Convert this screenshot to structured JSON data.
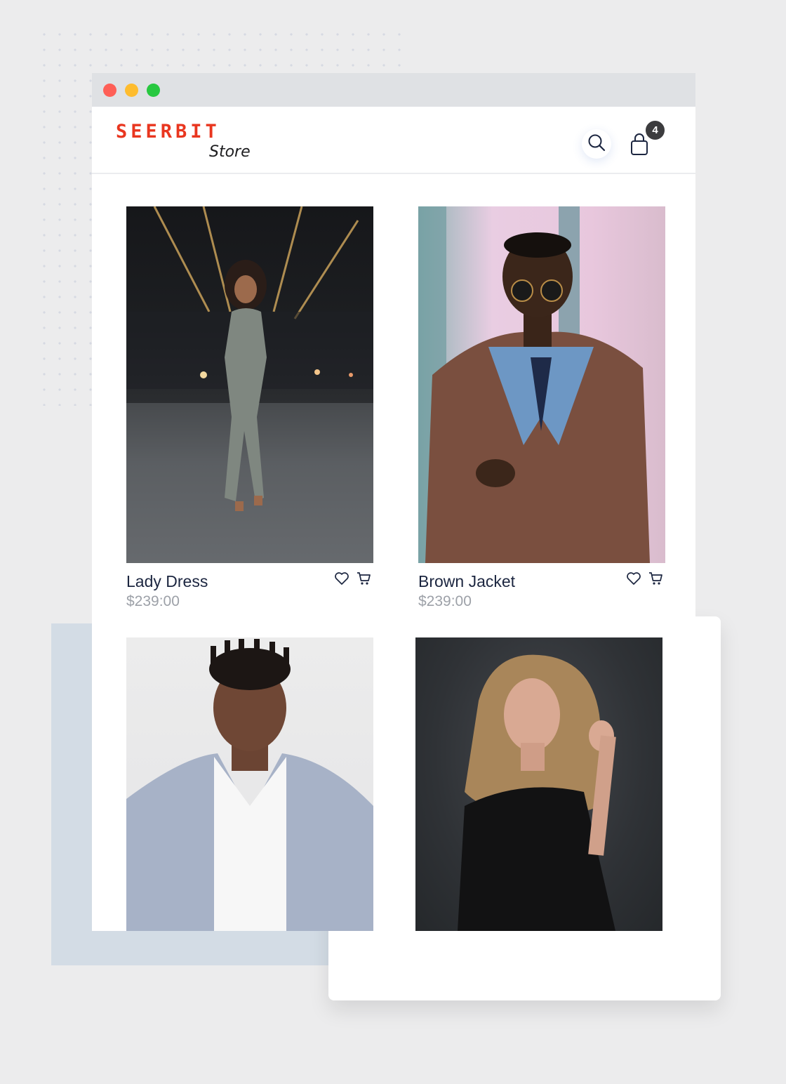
{
  "brand": {
    "logo_text": "SEERBIT",
    "subtitle": "Store",
    "accent_color": "#e9361f"
  },
  "header": {
    "search_icon": "search-icon",
    "cart_icon": "shopping-bag-icon",
    "cart_count": "4"
  },
  "window": {
    "traffic_lights": [
      "#fe5f57",
      "#febc2e",
      "#28c840"
    ]
  },
  "products": [
    {
      "name": "Lady Dress",
      "price": "$239:00",
      "image": "woman in grey jumpsuit on city street"
    },
    {
      "name": "Brown Jacket",
      "price": "$239:00",
      "image": "man in brown leather jacket and sunglasses"
    },
    {
      "name": "",
      "price": "",
      "image": "young man in grey blazer"
    },
    {
      "name": "",
      "price": "",
      "image": "woman with long wavy hair in black top"
    }
  ]
}
